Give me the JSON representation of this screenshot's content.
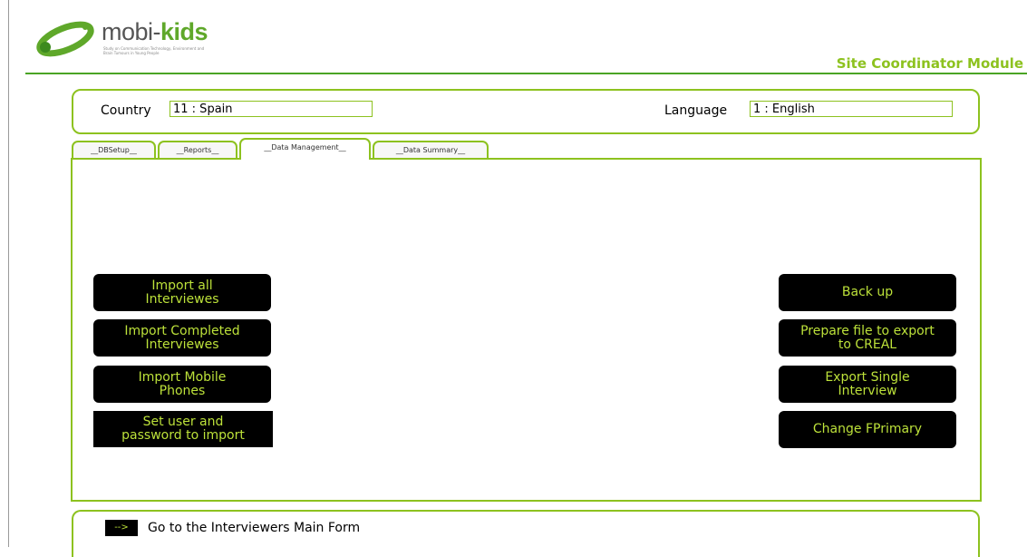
{
  "header": {
    "logo_prefix": "mobi-",
    "logo_suffix": "kids",
    "logo_tagline": "Study on Communication Technology, Environment and Brain Tumours in Young People",
    "module_title": "Site Coordinator Module"
  },
  "selection": {
    "country_label": "Country",
    "country_value": "11 : Spain",
    "language_label": "Language",
    "language_value": "1 : English"
  },
  "tabs": [
    {
      "label": "__DBSetup__",
      "active": false
    },
    {
      "label": "__Reports__",
      "active": false
    },
    {
      "label": "__Data Management__",
      "active": true
    },
    {
      "label": "__Data Summary__",
      "active": false
    }
  ],
  "left_buttons": [
    {
      "label": "Import all\nInterviewes"
    },
    {
      "label": "Import Completed\nInterviewes"
    },
    {
      "label": "Import Mobile\nPhones"
    },
    {
      "label": "Set user and\npassword to import"
    }
  ],
  "right_buttons": [
    {
      "label": "Back up"
    },
    {
      "label": "Prepare file to export\nto CREAL"
    },
    {
      "label": "Export Single\nInterview"
    },
    {
      "label": "Change FPrimary"
    }
  ],
  "footer": {
    "go_button": "-->",
    "go_label": "Go to the Interviewers Main Form"
  },
  "colors": {
    "accent": "#8dc21f",
    "button_bg": "#000000",
    "button_text": "#bde23a",
    "header_rule": "#4aa424"
  }
}
